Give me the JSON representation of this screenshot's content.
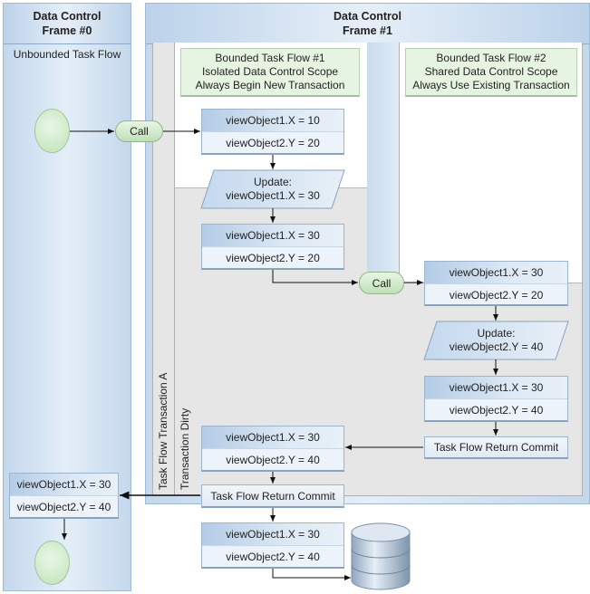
{
  "frame0": {
    "title_line1": "Data Control",
    "title_line2": "Frame #0",
    "label": "Unbounded Task Flow"
  },
  "frame1": {
    "title_line1": "Data Control",
    "title_line2": "Frame #1"
  },
  "lanes": {
    "transaction": "Task Flow Transaction A",
    "dirty": "Transaction Dirty"
  },
  "btf1": {
    "line1": "Bounded Task Flow #1",
    "line2": "Isolated Data Control Scope",
    "line3": "Always Begin New Transaction"
  },
  "btf2": {
    "line1": "Bounded Task Flow #2",
    "line2": "Shared Data Control Scope",
    "line3": "Always Use Existing Transaction"
  },
  "call_label": "Call",
  "update1": {
    "line1": "Update:",
    "line2": "viewObject1.X = 30"
  },
  "update2": {
    "line1": "Update:",
    "line2": "viewObject2.Y = 40"
  },
  "commit_label": "Task Flow Return Commit",
  "states": [
    {
      "x": "viewObject1.X = 10",
      "y": "viewObject2.Y = 20"
    },
    {
      "x": "viewObject1.X = 30",
      "y": "viewObject2.Y = 20"
    },
    {
      "x": "viewObject1.X = 30",
      "y": "viewObject2.Y = 20"
    },
    {
      "x": "viewObject1.X = 30",
      "y": "viewObject2.Y = 40"
    },
    {
      "x": "viewObject1.X = 30",
      "y": "viewObject2.Y = 40"
    },
    {
      "x": "viewObject1.X = 30",
      "y": "viewObject2.Y = 40"
    },
    {
      "x": "viewObject1.X = 30",
      "y": "viewObject2.Y = 40"
    }
  ],
  "icons": {
    "start": "start-node-circle",
    "end": "end-node-circle",
    "database": "database-cylinder"
  }
}
